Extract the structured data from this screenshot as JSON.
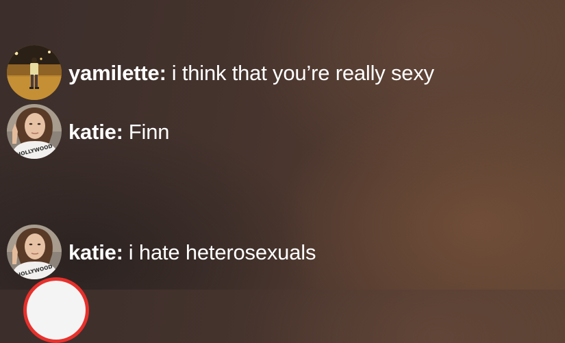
{
  "messages": [
    {
      "username": "yamilette",
      "text": "i think that you’re really sexy",
      "avatar": "yamilette-avatar"
    },
    {
      "username": "katie",
      "text": "Finn",
      "avatar": "katie-avatar"
    },
    {
      "username": "katie",
      "text": "i hate heterosexuals",
      "avatar": "katie-avatar"
    }
  ],
  "avatar_shirt_text": "HOLLYWOOD",
  "colors": {
    "text": "#ffffff",
    "record_ring": "#e8302b"
  }
}
